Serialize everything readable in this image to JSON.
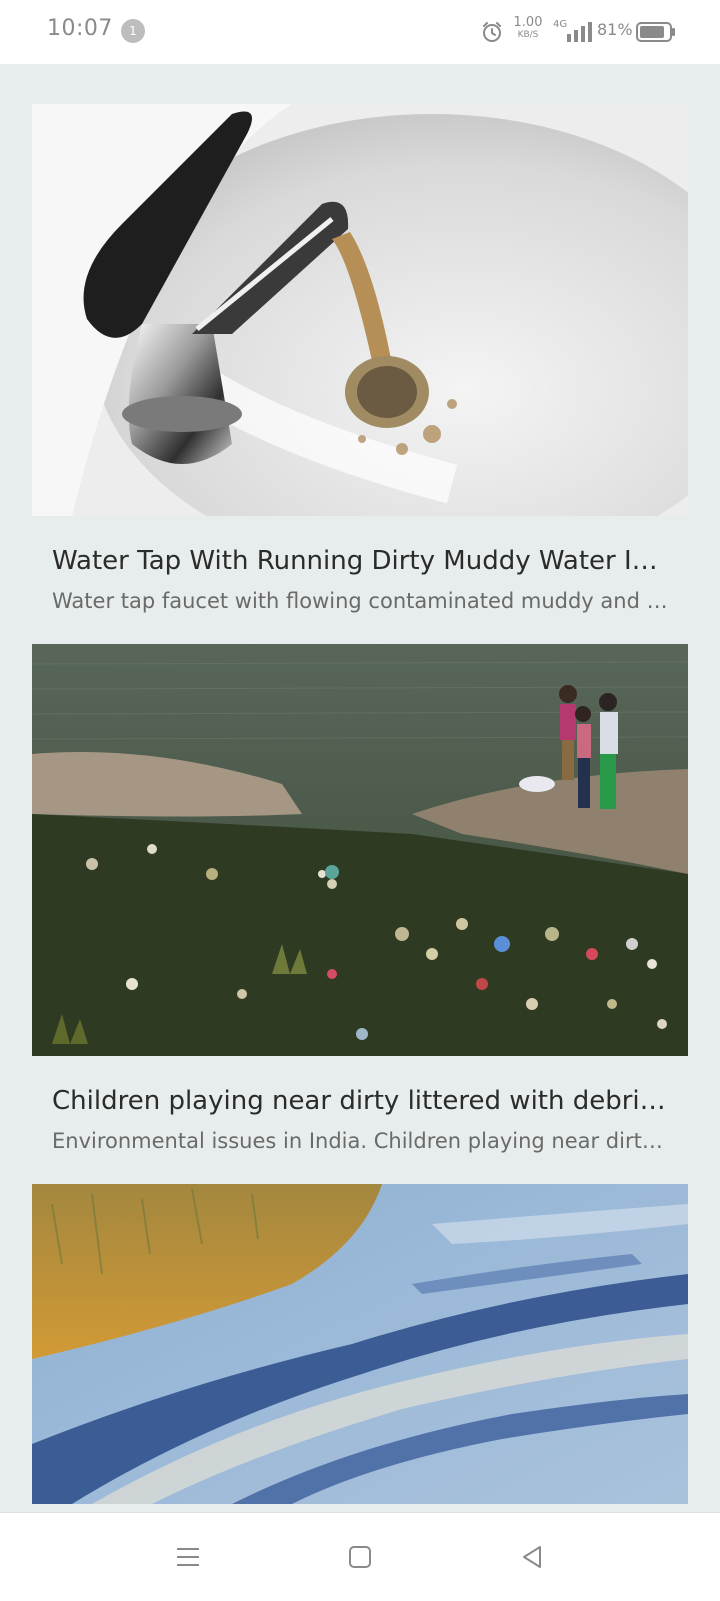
{
  "status_bar": {
    "time": "10:07",
    "notification_count": "1",
    "net_speed_value": "1.00",
    "net_speed_unit": "KB/S",
    "network_type": "4G",
    "battery_percent": "81%",
    "icons": [
      "alarm-icon",
      "signal-icon",
      "battery-icon"
    ]
  },
  "feed": {
    "cards": [
      {
        "title": "Water Tap With Running Dirty Muddy Water In Sink",
        "description": "Water tap faucet with flowing contaminated muddy and dirty water into a sink"
      },
      {
        "title": "Children playing near dirty littered with debris water",
        "description": "Environmental issues in India. Children playing near dirty water littered with debris"
      },
      {
        "title": "",
        "description": ""
      }
    ]
  },
  "nav_bar": {
    "icons": [
      "menu-icon",
      "home-icon",
      "back-icon"
    ]
  }
}
